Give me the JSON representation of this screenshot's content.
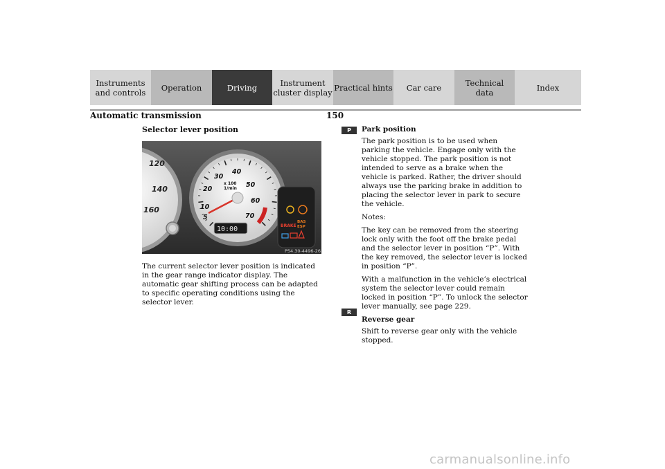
{
  "nav": {
    "tabs": [
      {
        "label": "Instruments\nand controls",
        "style": "lt"
      },
      {
        "label": "Operation",
        "style": "dk"
      },
      {
        "label": "Driving",
        "style": "active"
      },
      {
        "label": "Instrument\ncluster display",
        "style": "lt"
      },
      {
        "label": "Practical hints",
        "style": "dk"
      },
      {
        "label": "Car care",
        "style": "lt"
      },
      {
        "label": "Technical\ndata",
        "style": "dk"
      },
      {
        "label": "Index",
        "style": "lt"
      }
    ]
  },
  "header": {
    "section_title": "Automatic transmission",
    "page_number": "150"
  },
  "left": {
    "subhead": "Selector lever position",
    "figure": {
      "tach_scale": [
        "5",
        "10",
        "20",
        "30",
        "40",
        "50",
        "60",
        "70"
      ],
      "tach_unit_top": "x 100",
      "tach_unit_bottom": "1/min",
      "speedo_scale": [
        "120",
        "140",
        "160"
      ],
      "odometer": "10:00",
      "brake_label": "BRAKE",
      "bas_label": "BAS",
      "esp_label": "ESP",
      "code": "P54.30-4496-26",
      "colors": {
        "panel": "#2e2e2e",
        "needle": "#d8342a",
        "warning": "#e87a1e",
        "redzone": "#cc2222"
      }
    },
    "text": "The current selector lever position is indicated in the gear range indicator display. The automatic gear shifting process can be adapted to specific operating conditions using the selector lever."
  },
  "right": {
    "p_marker": "P",
    "p_heading": "Park position",
    "p_text": "The park position is to be used when parking the vehicle. Engage only with the vehicle stopped. The park position is not intended to serve as a brake when the vehicle is parked. Rather, the driver should always use the parking brake in addition to placing the selector lever in park to secure the vehicle.",
    "notes_label": "Notes:",
    "note1": "The key can be removed from the steering lock only with the foot off the brake pedal and the selector lever in position “P”. With the key removed, the selector lever is locked in position “P”.",
    "note2": "With a malfunction in the vehicle’s electrical system the selector lever could remain locked in position “P”. To unlock the selector lever manually, see page 229.",
    "r_marker": "R",
    "r_heading": "Reverse gear",
    "r_text": "Shift to reverse gear only with the vehicle stopped."
  },
  "footer": {
    "watermark": "carmanualsonline.info"
  }
}
